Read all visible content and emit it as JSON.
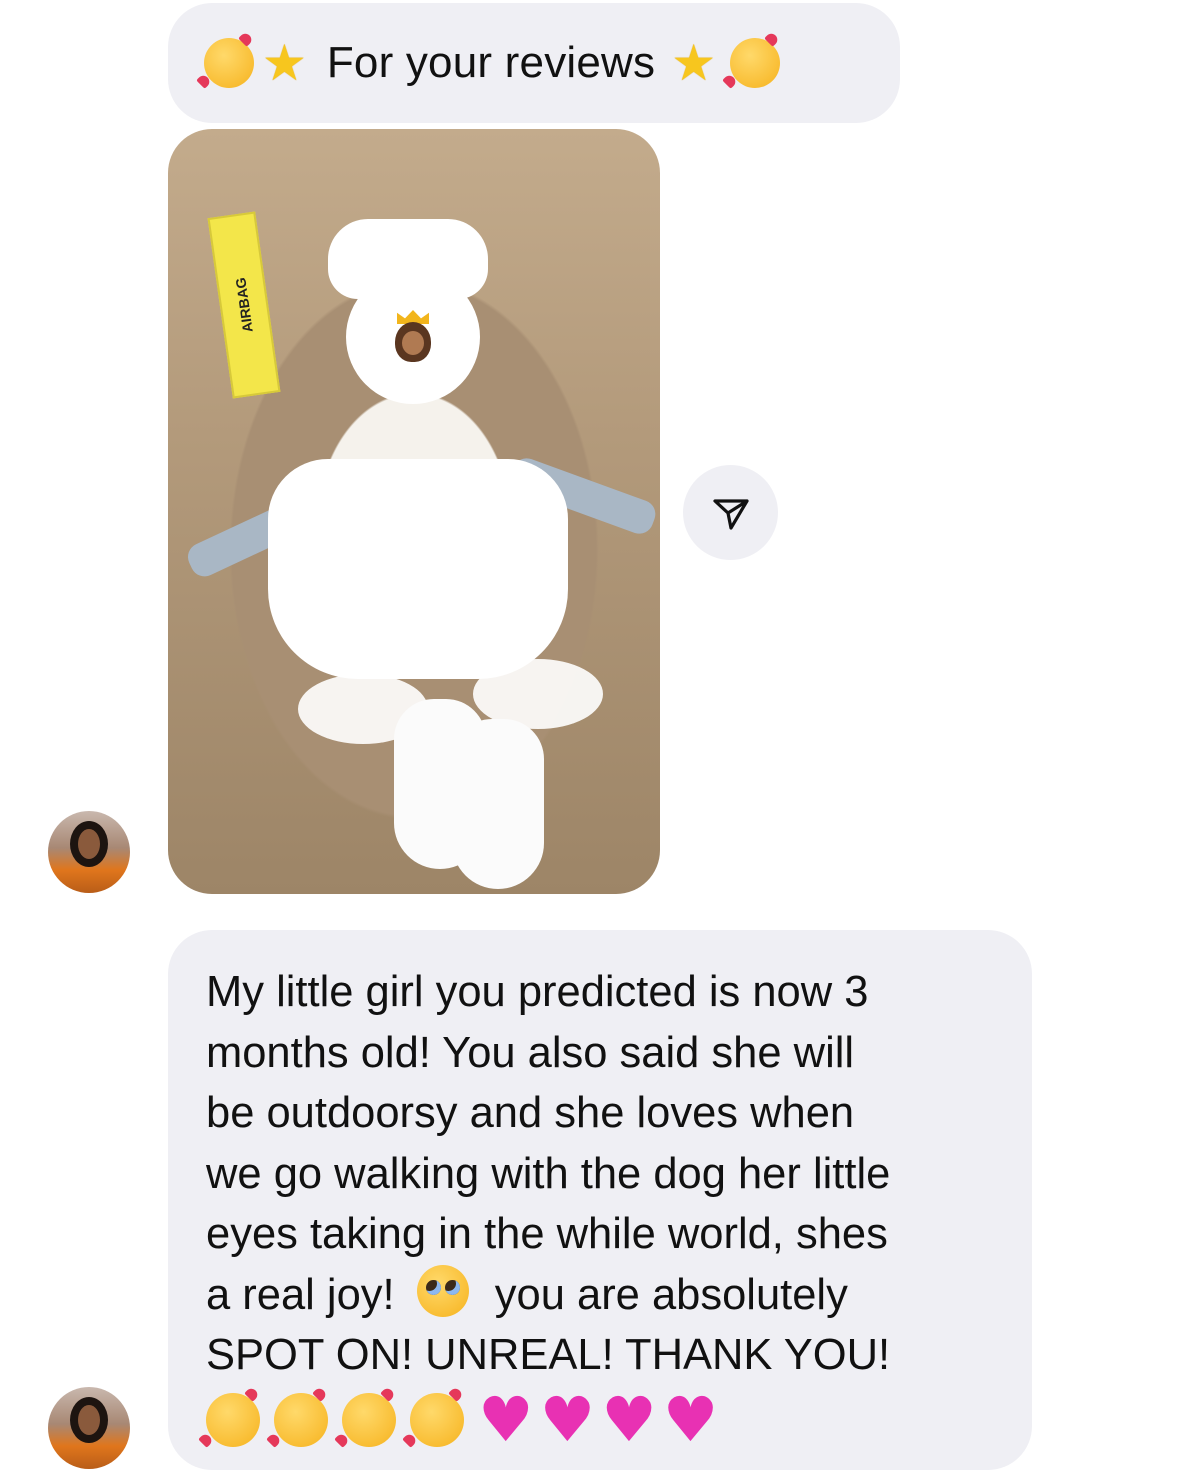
{
  "messages": [
    {
      "type": "text",
      "text": "For your reviews",
      "leading_emojis": [
        "smiling-face-with-hearts",
        "star"
      ],
      "trailing_emojis": [
        "star",
        "smiling-face-with-hearts"
      ]
    },
    {
      "type": "image",
      "image_label_text": "AIRBAG",
      "face_cover_emoji": "princess-medium-dark-skin",
      "share_icon": "paper-plane-icon"
    },
    {
      "type": "text",
      "lines": [
        "My little girl you predicted is now 3",
        "months old! You also said she will",
        "be outdoorsy and she loves when",
        "we go walking with the dog her little",
        "eyes taking in the while world, shes",
        "a real joy!",
        "you are absolutely",
        "SPOT ON! UNREAL! THANK YOU!"
      ],
      "inline_emoji": "pleading-face",
      "trailing_emojis": [
        "smiling-face-with-hearts",
        "smiling-face-with-hearts",
        "smiling-face-with-hearts",
        "smiling-face-with-hearts",
        "pink-heart",
        "pink-heart",
        "pink-heart",
        "pink-heart"
      ]
    }
  ],
  "colors": {
    "bubble_bg": "#efeff4",
    "text": "#111111",
    "heart": "#e831b3"
  }
}
